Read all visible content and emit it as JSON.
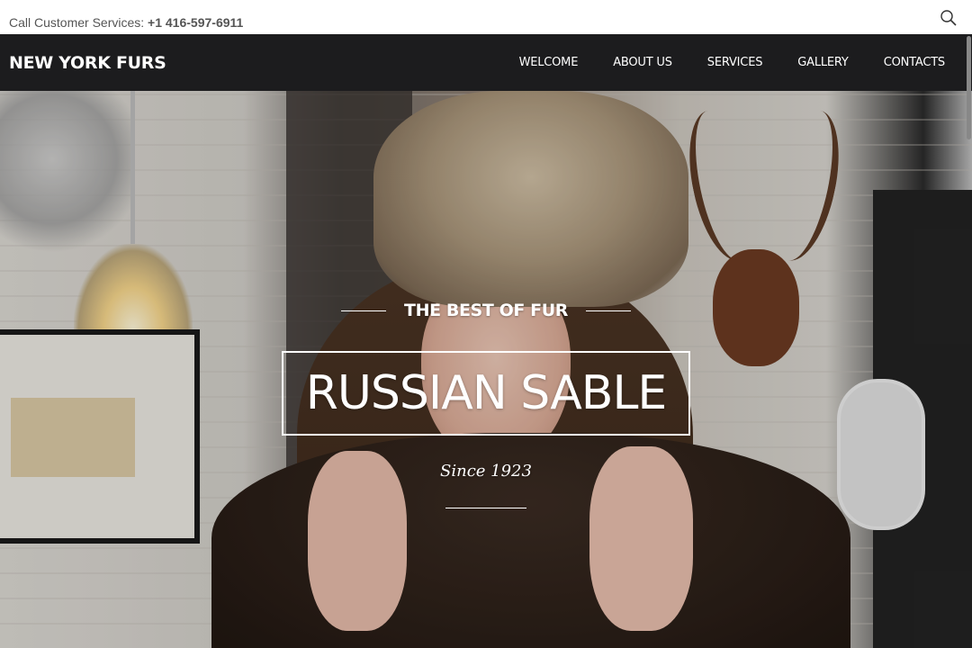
{
  "topbar": {
    "phone_label": "Call Customer Services:",
    "phone_number": "+1 416-597-6911",
    "search_icon": "search-icon"
  },
  "nav": {
    "brand": "NEW YORK FURS",
    "items": [
      {
        "label": "WELCOME"
      },
      {
        "label": "ABOUT US"
      },
      {
        "label": "SERVICES"
      },
      {
        "label": "GALLERY"
      },
      {
        "label": "CONTACTS"
      }
    ]
  },
  "hero": {
    "kicker": "THE BEST OF FUR",
    "title": "RUSSIAN SABLE",
    "since": "Since 1923"
  },
  "colors": {
    "nav_bg": "#1c1c1e",
    "text_light": "#ffffff",
    "phone_text": "#555555"
  }
}
